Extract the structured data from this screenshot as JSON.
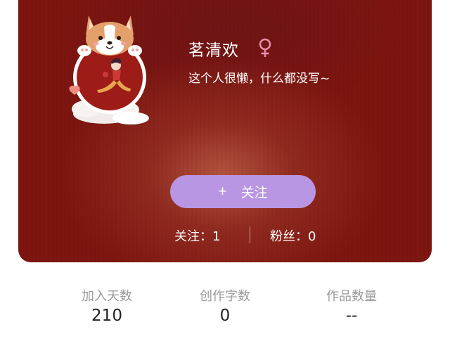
{
  "profile": {
    "username": "茗清欢",
    "gender": "female",
    "gender_symbol": "♀",
    "bio": "这个人很懒，什么都没写~",
    "avatar_icon": "corgi-avatar-frame"
  },
  "follow_button": {
    "icon": "+",
    "label": "关注"
  },
  "social": {
    "following_label": "关注：",
    "following_count": "1",
    "fans_label": "粉丝：",
    "fans_count": "0"
  },
  "metrics": [
    {
      "label": "加入天数",
      "value": "210"
    },
    {
      "label": "创作字数",
      "value": "0"
    },
    {
      "label": "作品数量",
      "value": "--"
    }
  ],
  "colors": {
    "hero_bg": "#7d1510",
    "button_bg": "#b896e3",
    "gender_pink": "#e98aa3"
  }
}
